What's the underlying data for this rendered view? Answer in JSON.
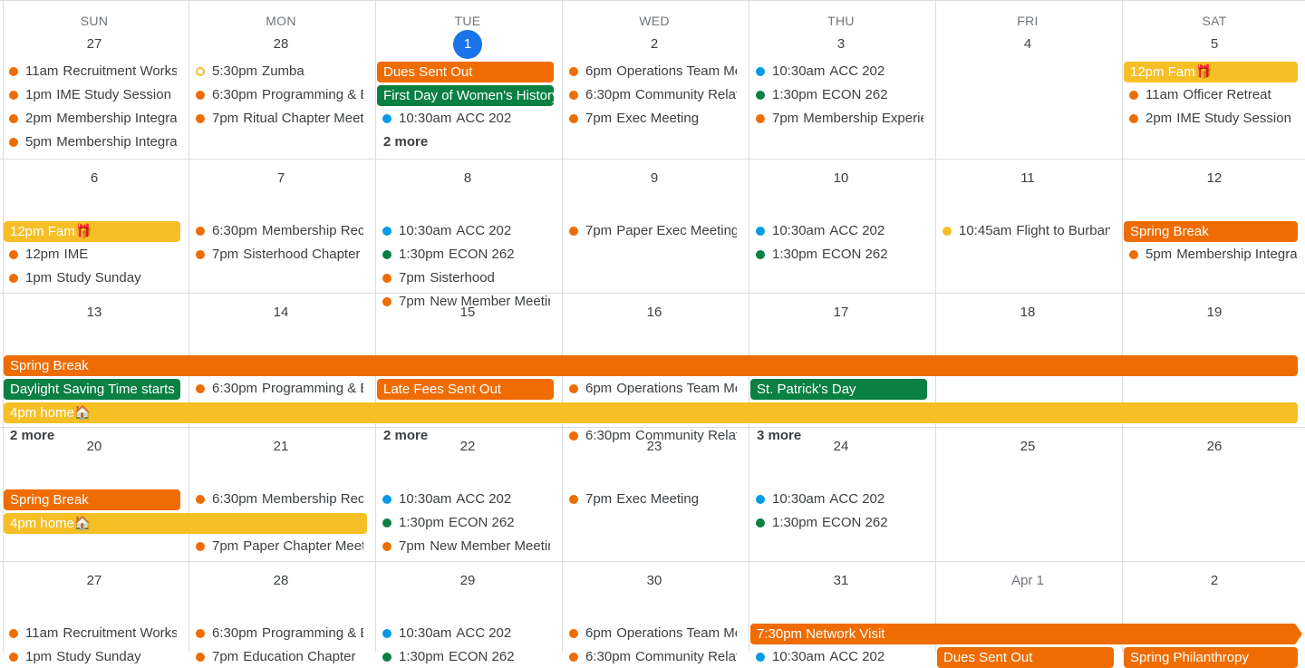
{
  "colors": {
    "orange": "#ef6c00",
    "green": "#0b8043",
    "yellow": "#f6bf26",
    "blue": "#039be5",
    "today": "#1a73e8"
  },
  "weekdays": [
    "SUN",
    "MON",
    "TUE",
    "WED",
    "THU",
    "FRI",
    "SAT"
  ],
  "weeks": [
    {
      "days": [
        "27",
        "28",
        "1",
        "2",
        "3",
        "4",
        "5"
      ],
      "today_col": 2
    },
    {
      "days": [
        "6",
        "7",
        "8",
        "9",
        "10",
        "11",
        "12"
      ]
    },
    {
      "days": [
        "13",
        "14",
        "15",
        "16",
        "17",
        "18",
        "19"
      ]
    },
    {
      "days": [
        "20",
        "21",
        "22",
        "23",
        "24",
        "25",
        "26"
      ]
    },
    {
      "days": [
        "27",
        "28",
        "29",
        "30",
        "31",
        "Apr 1",
        "2"
      ],
      "muted_cols": [
        5
      ]
    }
  ],
  "events": [
    {
      "w": 0,
      "c": 0,
      "r": 1,
      "dot": "orange",
      "time": "11am",
      "title": "Recruitment Workshop"
    },
    {
      "w": 0,
      "c": 0,
      "r": 2,
      "dot": "orange",
      "time": "1pm",
      "title": "IME Study Session"
    },
    {
      "w": 0,
      "c": 0,
      "r": 3,
      "dot": "orange",
      "time": "2pm",
      "title": "Membership Integration"
    },
    {
      "w": 0,
      "c": 0,
      "r": 4,
      "dot": "orange",
      "time": "5pm",
      "title": "Membership Integration"
    },
    {
      "w": 0,
      "c": 1,
      "r": 1,
      "dot": "hollow",
      "time": "5:30pm",
      "title": "Zumba"
    },
    {
      "w": 0,
      "c": 1,
      "r": 2,
      "dot": "orange",
      "time": "6:30pm",
      "title": "Programming & Events"
    },
    {
      "w": 0,
      "c": 1,
      "r": 3,
      "dot": "orange",
      "time": "7pm",
      "title": "Ritual Chapter Meeting"
    },
    {
      "w": 0,
      "c": 2,
      "r": 3,
      "dot": "blue",
      "time": "10:30am",
      "title": "ACC 202"
    },
    {
      "w": 0,
      "c": 3,
      "r": 1,
      "dot": "orange",
      "time": "6pm",
      "title": "Operations Team Meeting"
    },
    {
      "w": 0,
      "c": 3,
      "r": 2,
      "dot": "orange",
      "time": "6:30pm",
      "title": "Community Relations"
    },
    {
      "w": 0,
      "c": 3,
      "r": 3,
      "dot": "orange",
      "time": "7pm",
      "title": "Exec Meeting"
    },
    {
      "w": 0,
      "c": 4,
      "r": 1,
      "dot": "blue",
      "time": "10:30am",
      "title": "ACC 202"
    },
    {
      "w": 0,
      "c": 4,
      "r": 2,
      "dot": "green",
      "time": "1:30pm",
      "title": "ECON 262"
    },
    {
      "w": 0,
      "c": 4,
      "r": 3,
      "dot": "orange",
      "time": "7pm",
      "title": "Membership Experience"
    },
    {
      "w": 0,
      "c": 6,
      "r": 2,
      "dot": "orange",
      "time": "11am",
      "title": "Officer Retreat"
    },
    {
      "w": 0,
      "c": 6,
      "r": 3,
      "dot": "orange",
      "time": "2pm",
      "title": "IME Study Session"
    },
    {
      "w": 1,
      "c": 0,
      "r": 2,
      "dot": "orange",
      "time": "12pm",
      "title": "IME"
    },
    {
      "w": 1,
      "c": 0,
      "r": 3,
      "dot": "orange",
      "time": "1pm",
      "title": "Study Sunday"
    },
    {
      "w": 1,
      "c": 1,
      "r": 1,
      "dot": "orange",
      "time": "6:30pm",
      "title": "Membership Recruitment"
    },
    {
      "w": 1,
      "c": 1,
      "r": 2,
      "dot": "orange",
      "time": "7pm",
      "title": "Sisterhood Chapter"
    },
    {
      "w": 1,
      "c": 2,
      "r": 1,
      "dot": "blue",
      "time": "10:30am",
      "title": "ACC 202"
    },
    {
      "w": 1,
      "c": 2,
      "r": 2,
      "dot": "green",
      "time": "1:30pm",
      "title": "ECON 262"
    },
    {
      "w": 1,
      "c": 2,
      "r": 3,
      "dot": "orange",
      "time": "7pm",
      "title": "Sisterhood"
    },
    {
      "w": 1,
      "c": 2,
      "r": 4,
      "dot": "orange",
      "time": "7pm",
      "title": "New Member Meeting"
    },
    {
      "w": 1,
      "c": 3,
      "r": 1,
      "dot": "orange",
      "time": "7pm",
      "title": "Paper Exec Meeting"
    },
    {
      "w": 1,
      "c": 4,
      "r": 1,
      "dot": "blue",
      "time": "10:30am",
      "title": "ACC 202"
    },
    {
      "w": 1,
      "c": 4,
      "r": 2,
      "dot": "green",
      "time": "1:30pm",
      "title": "ECON 262"
    },
    {
      "w": 1,
      "c": 5,
      "r": 1,
      "dot": "yellow",
      "time": "10:45am",
      "title": "Flight to Burbank"
    },
    {
      "w": 1,
      "c": 6,
      "r": 2,
      "dot": "orange",
      "time": "5pm",
      "title": "Membership Integration"
    },
    {
      "w": 2,
      "c": 1,
      "r": 2,
      "dot": "orange",
      "time": "6:30pm",
      "title": "Programming & Events"
    },
    {
      "w": 2,
      "c": 3,
      "r": 2,
      "dot": "orange",
      "time": "6pm",
      "title": "Operations Team Meeting"
    },
    {
      "w": 2,
      "c": 3,
      "r": 4,
      "dot": "orange",
      "time": "6:30pm",
      "title": "Community Relations"
    },
    {
      "w": 3,
      "c": 1,
      "r": 1,
      "dot": "orange",
      "time": "6:30pm",
      "title": "Membership Recruitment"
    },
    {
      "w": 3,
      "c": 1,
      "r": 3,
      "dot": "orange",
      "time": "7pm",
      "title": "Paper Chapter Meeting"
    },
    {
      "w": 3,
      "c": 2,
      "r": 1,
      "dot": "blue",
      "time": "10:30am",
      "title": "ACC 202"
    },
    {
      "w": 3,
      "c": 2,
      "r": 2,
      "dot": "green",
      "time": "1:30pm",
      "title": "ECON 262"
    },
    {
      "w": 3,
      "c": 2,
      "r": 3,
      "dot": "orange",
      "time": "7pm",
      "title": "New Member Meeting"
    },
    {
      "w": 3,
      "c": 3,
      "r": 1,
      "dot": "orange",
      "time": "7pm",
      "title": "Exec Meeting"
    },
    {
      "w": 3,
      "c": 4,
      "r": 1,
      "dot": "blue",
      "time": "10:30am",
      "title": "ACC 202"
    },
    {
      "w": 3,
      "c": 4,
      "r": 2,
      "dot": "green",
      "time": "1:30pm",
      "title": "ECON 262"
    },
    {
      "w": 4,
      "c": 0,
      "r": 1,
      "dot": "orange",
      "time": "11am",
      "title": "Recruitment Workshop"
    },
    {
      "w": 4,
      "c": 0,
      "r": 2,
      "dot": "orange",
      "time": "1pm",
      "title": "Study Sunday"
    },
    {
      "w": 4,
      "c": 1,
      "r": 1,
      "dot": "orange",
      "time": "6:30pm",
      "title": "Programming & Events"
    },
    {
      "w": 4,
      "c": 1,
      "r": 2,
      "dot": "orange",
      "time": "7pm",
      "title": "Education Chapter"
    },
    {
      "w": 4,
      "c": 2,
      "r": 1,
      "dot": "blue",
      "time": "10:30am",
      "title": "ACC 202"
    },
    {
      "w": 4,
      "c": 2,
      "r": 2,
      "dot": "green",
      "time": "1:30pm",
      "title": "ECON 262"
    },
    {
      "w": 4,
      "c": 3,
      "r": 1,
      "dot": "orange",
      "time": "6pm",
      "title": "Operations Team Meeting"
    },
    {
      "w": 4,
      "c": 3,
      "r": 2,
      "dot": "orange",
      "time": "6:30pm",
      "title": "Community Relations"
    },
    {
      "w": 4,
      "c": 4,
      "r": 2,
      "dot": "blue",
      "time": "10:30am",
      "title": "ACC 202"
    }
  ],
  "bars": [
    {
      "w": 0,
      "c": 2,
      "span": 1,
      "r": 1,
      "color": "orange",
      "label": "Dues Sent Out"
    },
    {
      "w": 0,
      "c": 2,
      "span": 1,
      "r": 2,
      "color": "green",
      "label": "First Day of Women's History Month"
    },
    {
      "w": 0,
      "c": 6,
      "span": 1,
      "r": 1,
      "color": "yellow",
      "label": "12pm Fam🎁"
    },
    {
      "w": 1,
      "c": 0,
      "span": 1,
      "r": 1,
      "color": "yellow",
      "label": "12pm Fam🎁"
    },
    {
      "w": 1,
      "c": 6,
      "span": 1,
      "r": 1,
      "color": "orange",
      "label": "Spring Break"
    },
    {
      "w": 2,
      "c": 0,
      "span": 7,
      "r": 1,
      "color": "orange",
      "label": "Spring Break"
    },
    {
      "w": 2,
      "c": 0,
      "span": 1,
      "r": 2,
      "color": "green",
      "label": "Daylight Saving Time starts"
    },
    {
      "w": 2,
      "c": 2,
      "span": 1,
      "r": 2,
      "color": "orange",
      "label": "Late Fees Sent Out"
    },
    {
      "w": 2,
      "c": 4,
      "span": 1,
      "r": 2,
      "color": "green",
      "label": "St. Patrick's Day"
    },
    {
      "w": 2,
      "c": 0,
      "span": 7,
      "r": 3,
      "color": "yellow",
      "label": "4pm home🏠"
    },
    {
      "w": 3,
      "c": 0,
      "span": 1,
      "r": 1,
      "color": "orange",
      "label": "Spring Break"
    },
    {
      "w": 3,
      "c": 0,
      "span": 2,
      "r": 2,
      "color": "yellow",
      "label": "4pm home🏠"
    },
    {
      "w": 4,
      "c": 4,
      "span": 3,
      "r": 1,
      "color": "orange",
      "label": "7:30pm Network Visit",
      "arrow": true
    },
    {
      "w": 4,
      "c": 5,
      "span": 1,
      "r": 2,
      "color": "orange",
      "label": "Dues Sent Out"
    },
    {
      "w": 4,
      "c": 6,
      "span": 1,
      "r": 2,
      "color": "orange",
      "label": "Spring Philanthropy"
    }
  ],
  "more": [
    {
      "w": 0,
      "c": 2,
      "r": 4,
      "label": "2 more"
    },
    {
      "w": 2,
      "c": 0,
      "r": 4,
      "label": "2 more"
    },
    {
      "w": 2,
      "c": 2,
      "r": 4,
      "label": "2 more"
    },
    {
      "w": 2,
      "c": 4,
      "r": 4,
      "label": "3 more"
    }
  ]
}
